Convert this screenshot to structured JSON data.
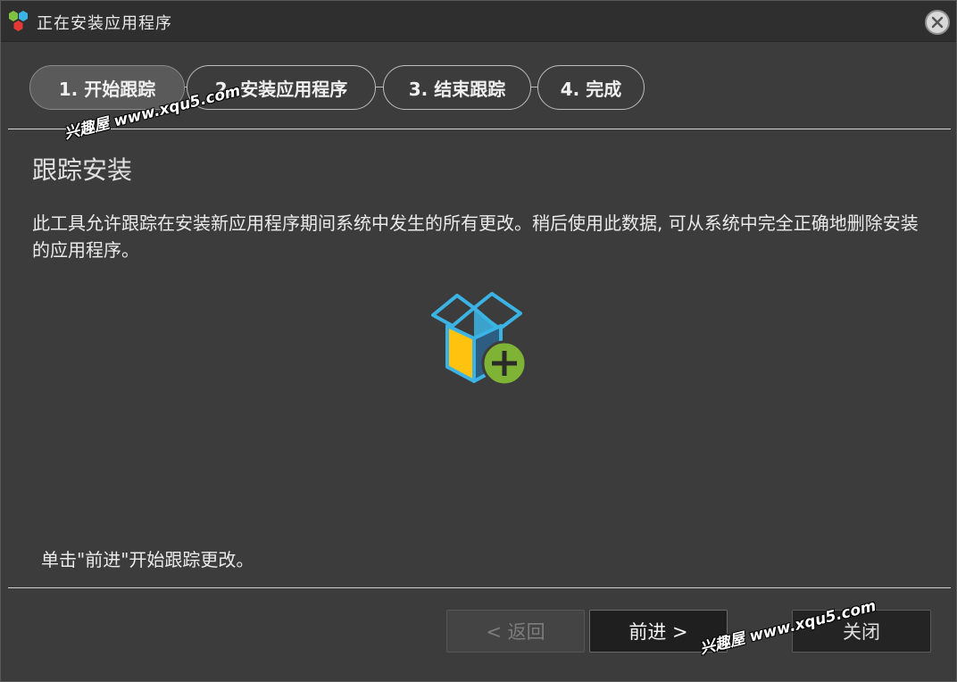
{
  "window": {
    "title": "正在安装应用程序",
    "close_label": "×"
  },
  "steps": [
    {
      "label": "1. 开始跟踪",
      "active": true
    },
    {
      "label": "2. 安装应用程序",
      "active": false
    },
    {
      "label": "3. 结束跟踪",
      "active": false
    },
    {
      "label": "4. 完成",
      "active": false
    }
  ],
  "content": {
    "section_title": "跟踪安装",
    "description": "此工具允许跟踪在安装新应用程序期间系统中发生的所有更改。稍后使用此数据, 可从系统中完全正确地删除安装的应用程序。",
    "hint": "单击\"前进\"开始跟踪更改。",
    "icon": "box-add-icon"
  },
  "buttons": {
    "back": "< 返回",
    "next": "前进 >",
    "close": "关闭"
  },
  "watermark": "兴趣屋 www.xqu5.com",
  "colors": {
    "background": "#3c3c3c",
    "titlebar": "#2f2f2f",
    "accent_green": "#7fb336",
    "accent_yellow": "#ffc20e",
    "accent_blue": "#3bb4e5"
  }
}
